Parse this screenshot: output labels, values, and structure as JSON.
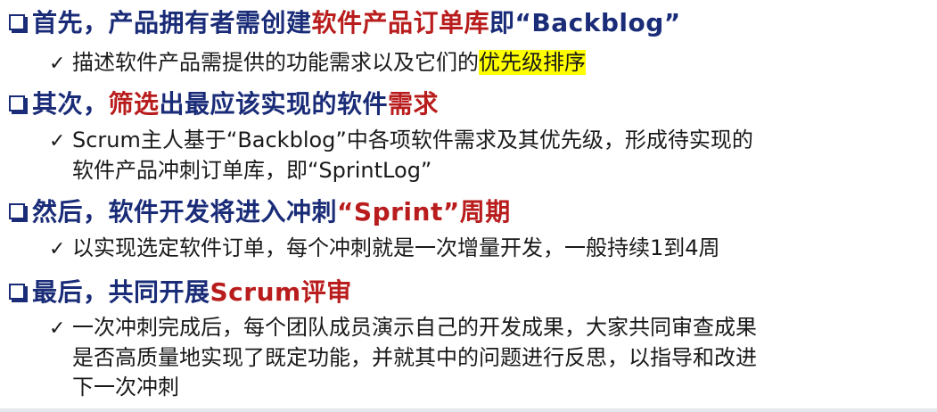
{
  "points": [
    {
      "title_pre": "首先，产品拥有者需创建",
      "title_red": "软件产品订单库",
      "title_post": "即“Backblog”",
      "subs": [
        {
          "pre": "描述软件产品需提供的功能需求以及它们的",
          "highlight": "优先级排序"
        }
      ]
    },
    {
      "title_pre": "其次，",
      "title_red": "筛选",
      "title_mid": "出最应该实现的软件",
      "title_red2": "需求",
      "subs": [
        {
          "line1": "Scrum主人基于“Backblog”中各项软件需求及其优先级，形成待实现的",
          "line2": "软件产品冲刺订单库，即“SprintLog”"
        }
      ]
    },
    {
      "title_pre": "然后，软件开发将进入冲刺",
      "title_red": "“Sprint”周期",
      "subs": [
        {
          "line1": "以实现选定软件订单，每个冲刺就是一次增量开发，一般持续1到4周"
        }
      ]
    },
    {
      "title_pre": "最后，共同开展",
      "title_red": "Scrum评审",
      "subs": [
        {
          "line1": "一次冲刺完成后，每个团队成员演示自己的开发成果，大家共同审查成果",
          "line2": "是否高质量地实现了既定功能，并就其中的问题进行反思，以指导和改进",
          "line3": "下一次冲刺"
        }
      ]
    }
  ],
  "colors": {
    "title": "#1a2c78",
    "emphasis": "#b91c1c",
    "highlight": "#ffff00",
    "body": "#1a1a1a"
  },
  "icons": {
    "bullet": "checkbox-icon",
    "sub_bullet": "checkmark-icon",
    "check_glyph": "✓"
  }
}
